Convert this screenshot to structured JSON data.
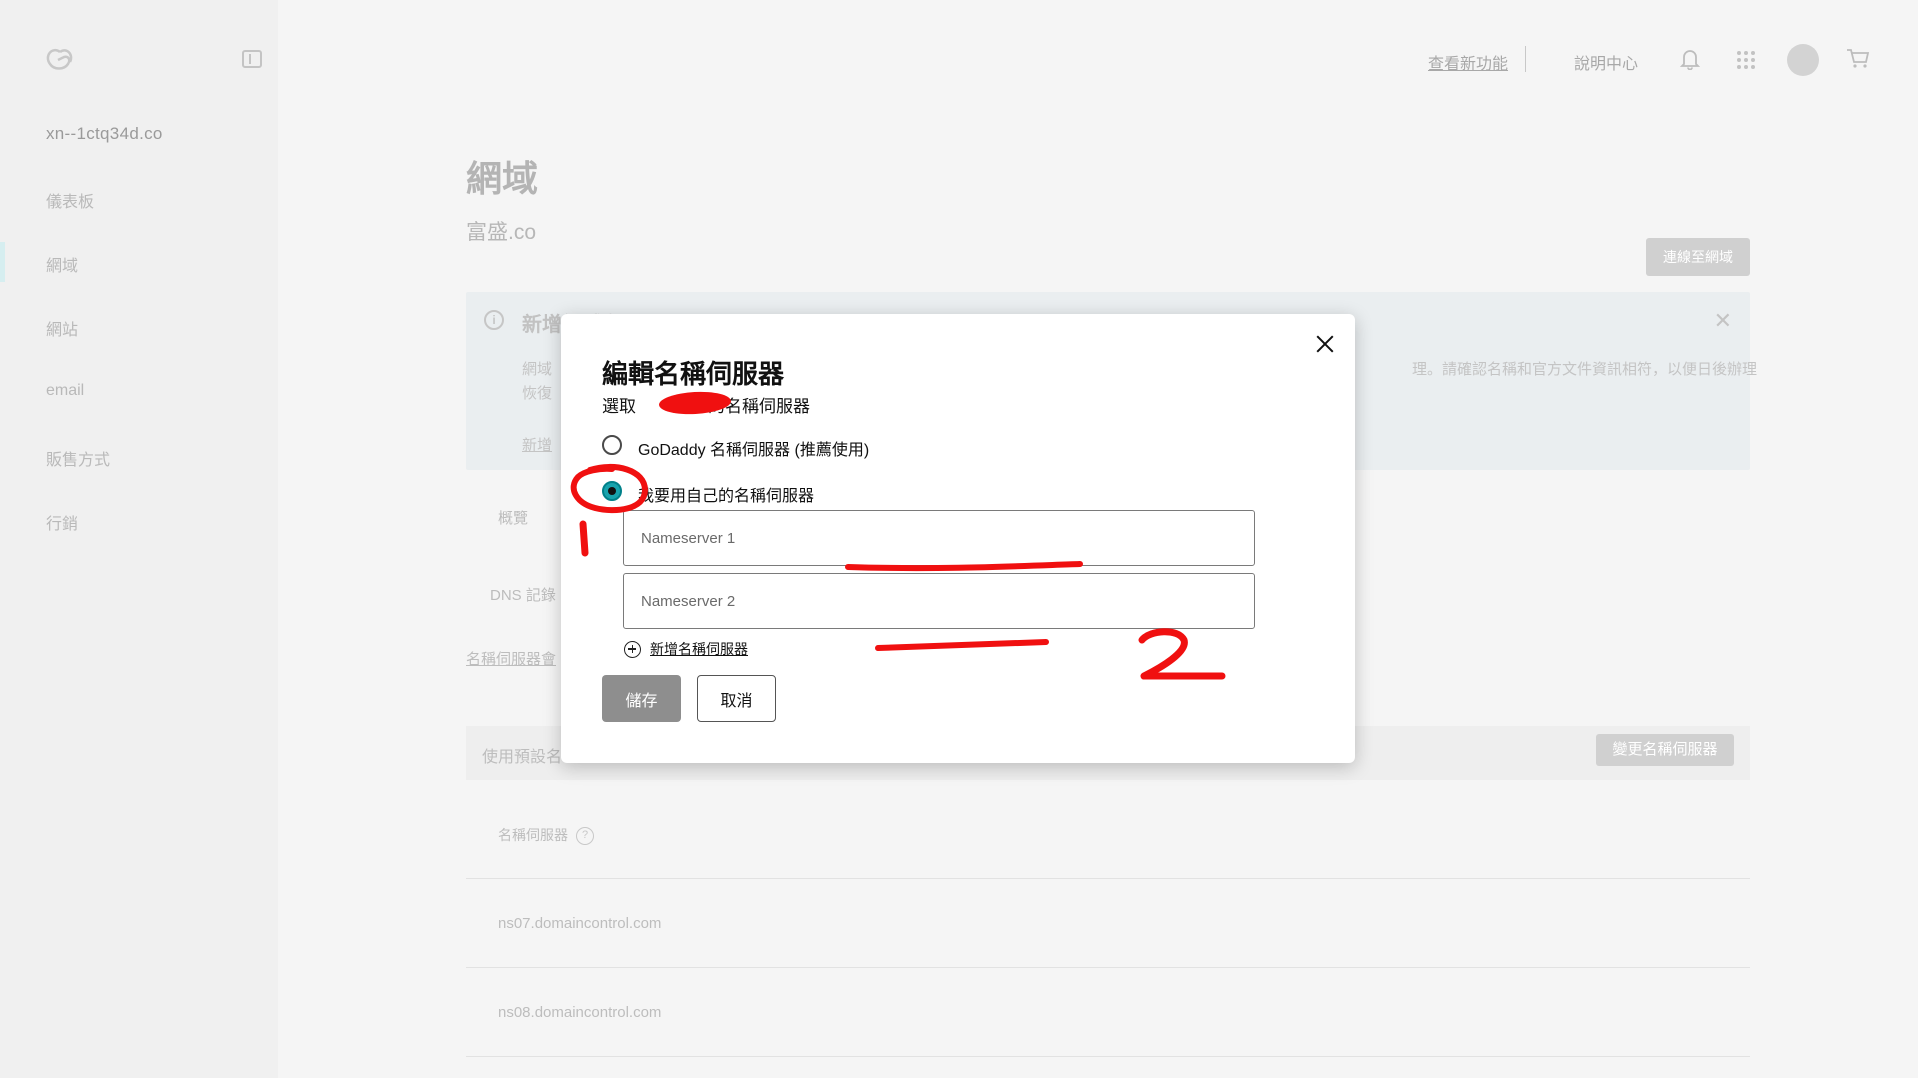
{
  "header": {
    "whats_new": "查看新功能",
    "help_center": "說明中心"
  },
  "sidebar": {
    "domain": "xn--1ctq34d.co",
    "items": [
      {
        "label": "儀表板"
      },
      {
        "label": "網域"
      },
      {
        "label": "網站"
      },
      {
        "label": "email"
      },
      {
        "label": "販售方式"
      },
      {
        "label": "行銷"
      }
    ]
  },
  "main": {
    "title": "網域",
    "subtitle": "富盛.co",
    "connect_button": "連線至網域",
    "info_panel": {
      "title": "新增網域名稱",
      "body_left_1": "網域",
      "body_left_2": "恢復",
      "body_right": "理。請確認名稱和官方文件資訊相符，以便日後辦理",
      "link": "新增"
    },
    "tabs": {
      "overview": "概覽",
      "dns_records": "DNS 記錄"
    },
    "ns_link": "名稱伺服器會",
    "default_bar_text": "使用預設名",
    "change_ns_button": "變更名稱伺服器",
    "ns_table_header": "名稱伺服器",
    "nameservers": [
      "ns07.domaincontrol.com",
      "ns08.domaincontrol.com"
    ]
  },
  "modal": {
    "title": "編輯名稱伺服器",
    "subtitle_prefix": "選取",
    "subtitle_suffix": "的名稱伺服器",
    "option_godaddy": "GoDaddy 名稱伺服器 (推薦使用)",
    "option_custom": "我要用自己的名稱伺服器",
    "ns1_placeholder": "Nameserver 1",
    "ns2_placeholder": "Nameserver 2",
    "add_nameserver": "新增名稱伺服器",
    "save": "儲存",
    "cancel": "取消"
  },
  "colors": {
    "accent_teal": "#18a3ad",
    "annotation_red": "#f01010"
  }
}
